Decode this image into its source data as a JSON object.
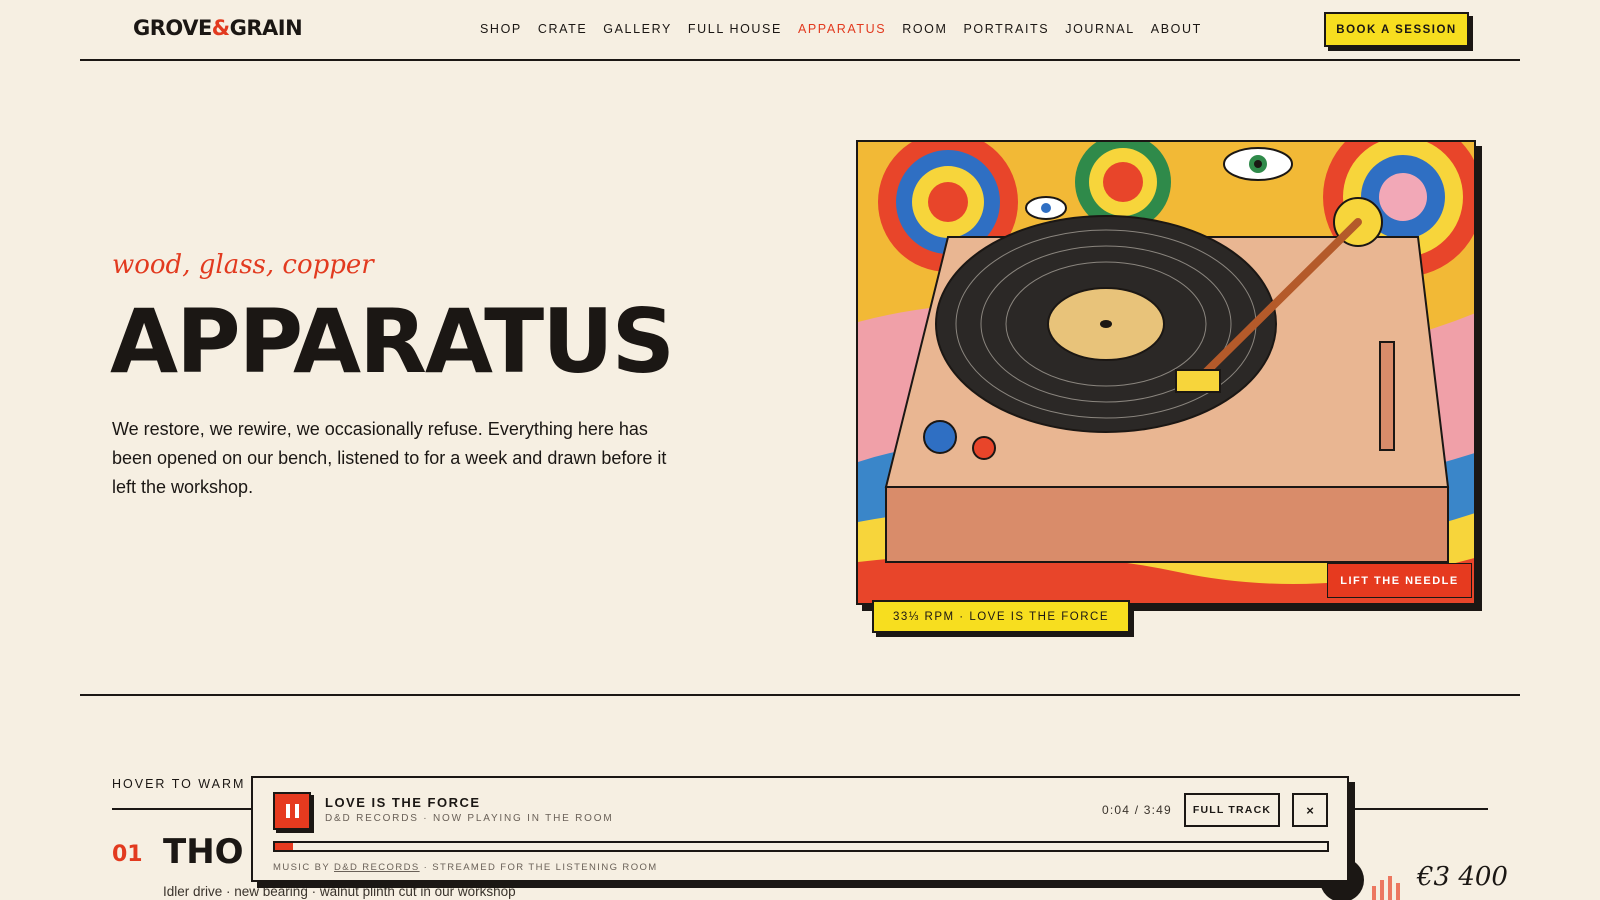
{
  "header": {
    "logo_left": "GROVE",
    "logo_amp": "&",
    "logo_right": "GRAIN",
    "nav": [
      "SHOP",
      "CRATE",
      "GALLERY",
      "FULL HOUSE",
      "APPARATUS",
      "ROOM",
      "PORTRAITS",
      "JOURNAL",
      "ABOUT"
    ],
    "active_nav": "APPARATUS",
    "book_label": "BOOK A SESSION"
  },
  "hero": {
    "kicker": "wood, glass, copper",
    "title": "APPARATUS",
    "body": "We restore, we rewire, we occasionally refuse. Everything here has been opened on our bench, listened to for a week and drawn before it left the workshop.",
    "needle_label": "LIFT THE NEEDLE",
    "rpm_label": "33⅓ RPM · LOVE IS THE FORCE"
  },
  "list": {
    "hint": "HOVER TO WARM I",
    "items": [
      {
        "num": "01",
        "title": "THO",
        "sub": "Idler drive · new bearing · walnut plinth cut in our workshop",
        "price": "€3 400"
      }
    ]
  },
  "player": {
    "title": "LOVE IS THE FORCE",
    "subtitle": "D&D RECORDS · NOW PLAYING IN THE ROOM",
    "time": "0:04 / 3:49",
    "progress": 0.017,
    "full_track_label": "FULL TRACK",
    "close_label": "×",
    "credit_prefix": "MUSIC BY",
    "credit_link": "D&D RECORDS",
    "credit_suffix": "· STREAMED FOR THE LISTENING ROOM"
  },
  "colors": {
    "accent": "#e23a1f",
    "highlight": "#f7de1f",
    "ink": "#1b1714",
    "paper": "#f6efe2"
  }
}
